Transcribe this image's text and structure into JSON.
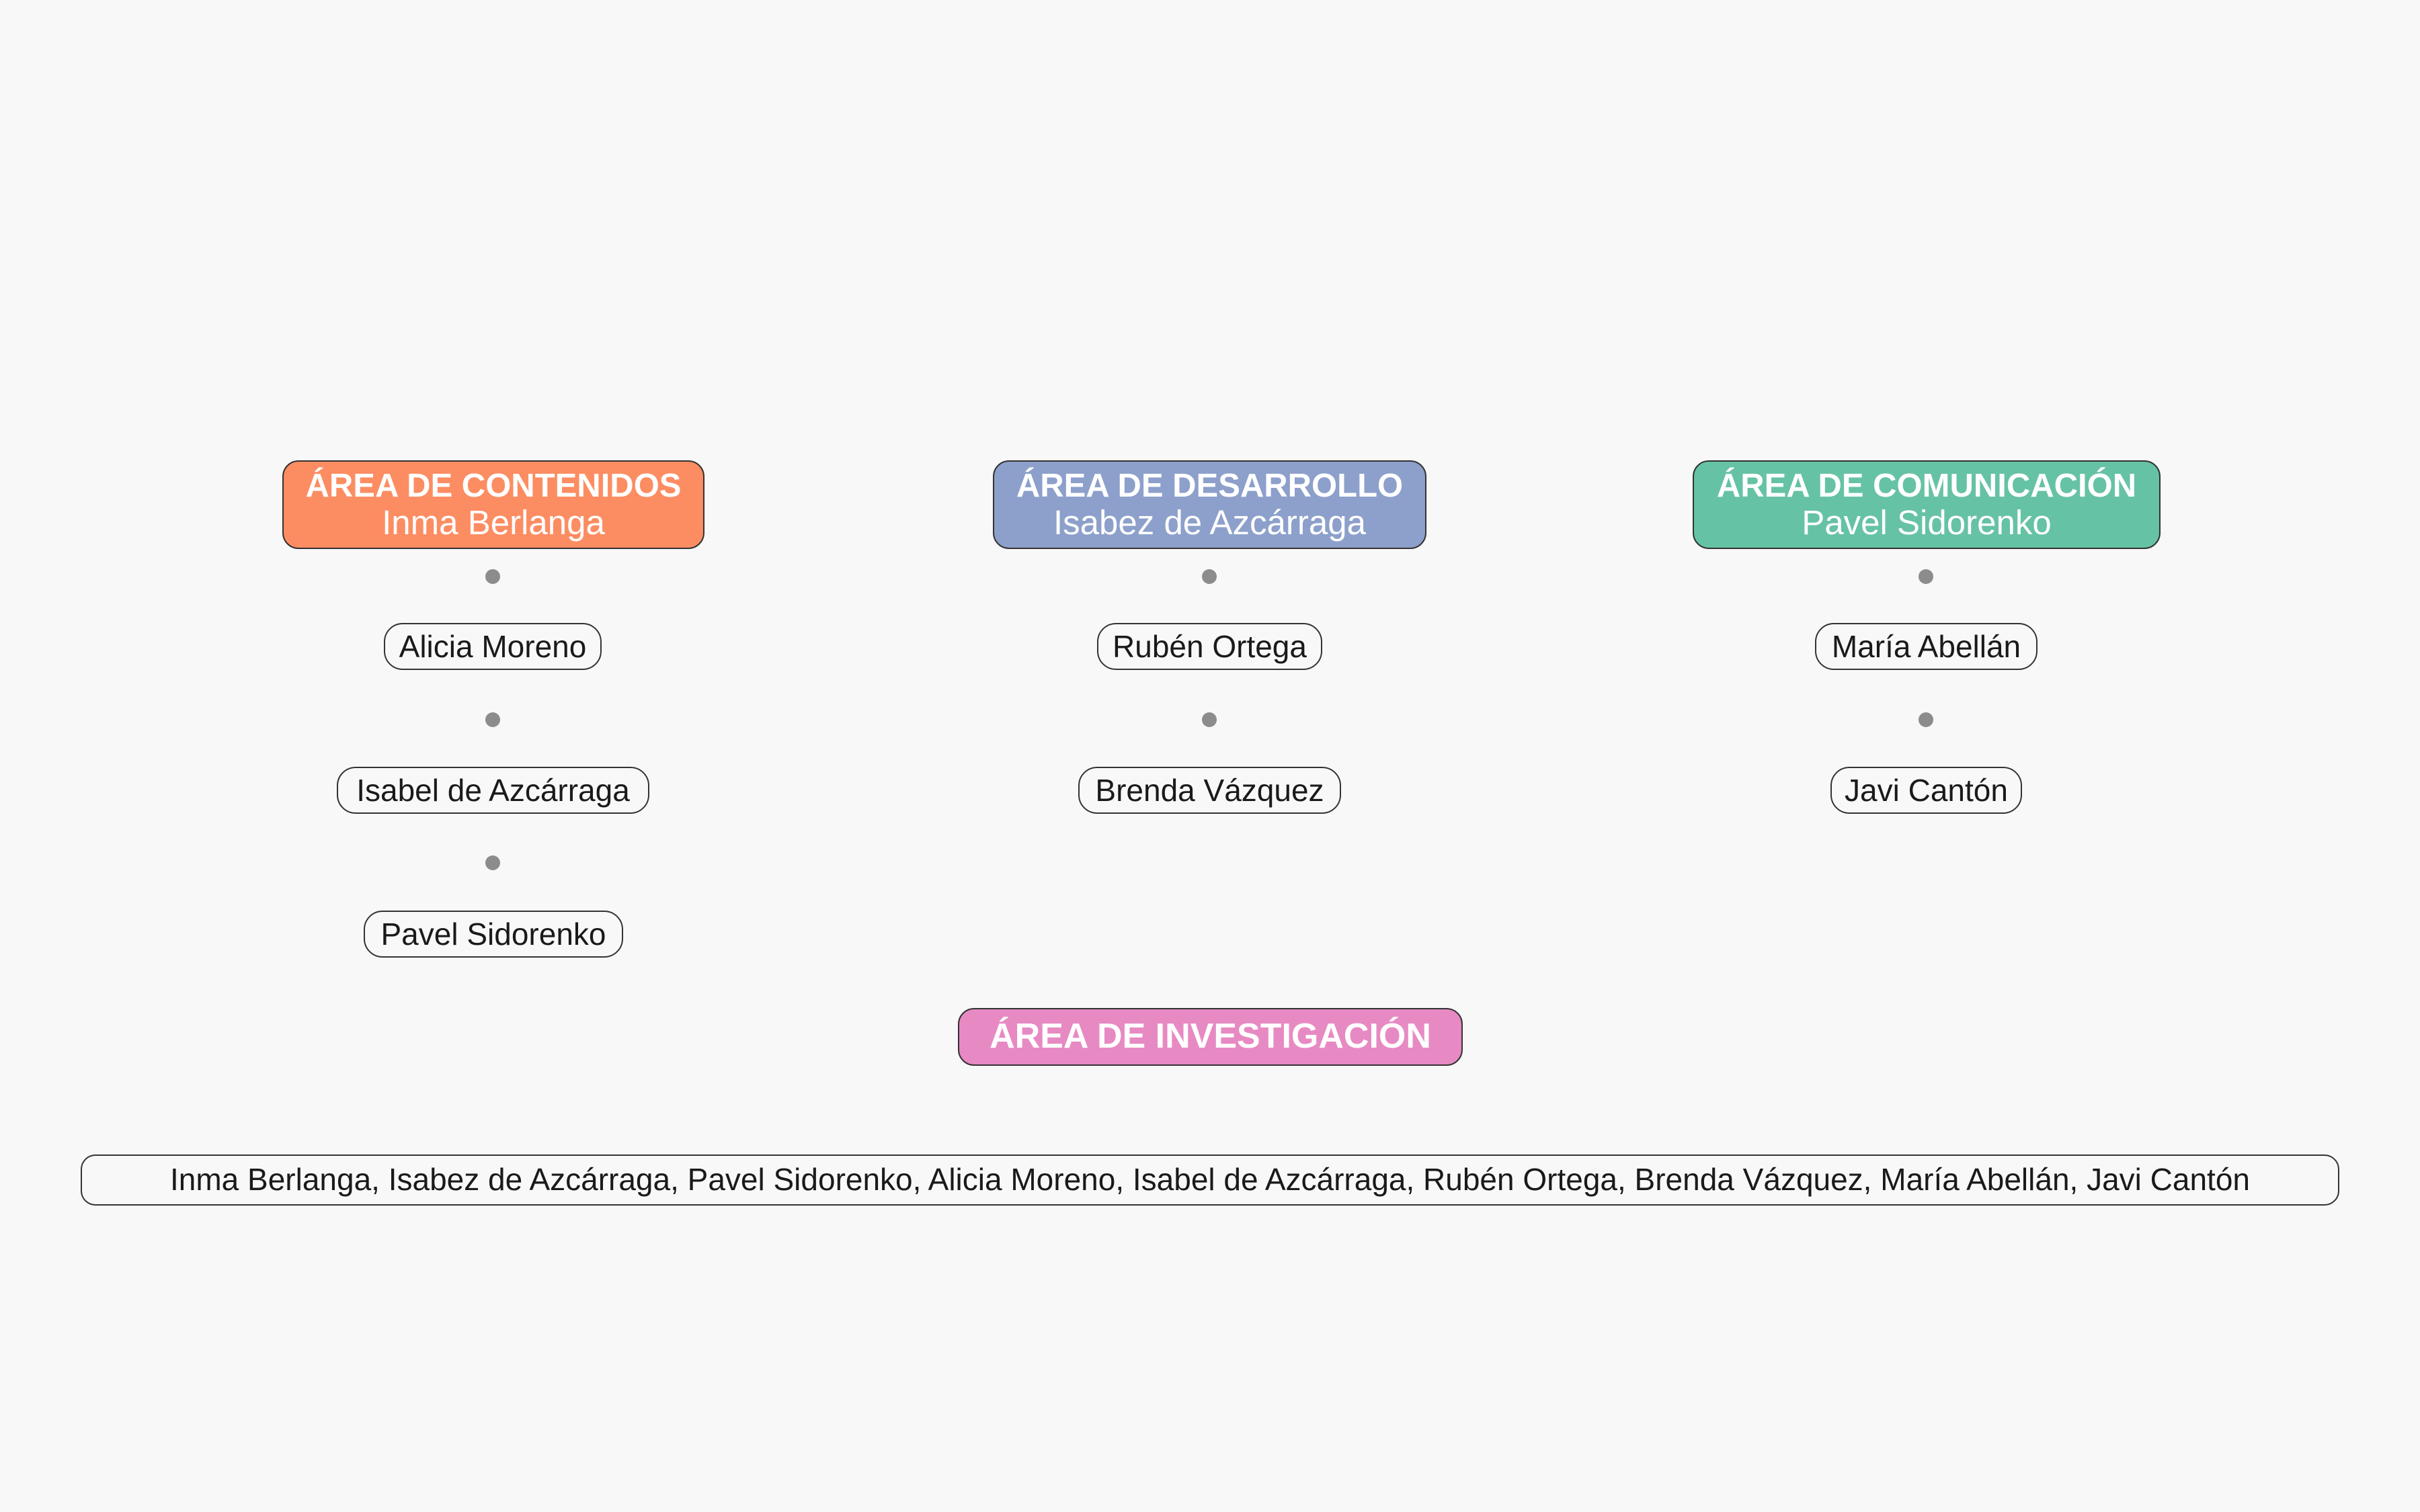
{
  "colors": {
    "contenidos": "#fc8d62",
    "desarrollo": "#8da0cb",
    "comunicacion": "#66c2a5",
    "investigacion": "#e78ac3",
    "connector_dot": "#8c8c8c",
    "border": "#333333",
    "background": "#f8f8f8"
  },
  "areas": [
    {
      "title": "ÁREA DE CONTENIDOS",
      "lead": "Inma Berlanga",
      "members": [
        "Alicia Moreno",
        "Isabel de Azcárraga",
        "Pavel Sidorenko"
      ]
    },
    {
      "title": "ÁREA DE DESARROLLO",
      "lead": "Isabez de Azcárraga",
      "members": [
        "Rubén Ortega",
        "Brenda Vázquez"
      ]
    },
    {
      "title": "ÁREA DE COMUNICACIÓN",
      "lead": "Pavel Sidorenko",
      "members": [
        "María Abellán",
        "Javi Cantón"
      ]
    }
  ],
  "investigacion": {
    "title": "ÁREA DE INVESTIGACIÓN",
    "members": "Inma Berlanga, Isabez de Azcárraga, Pavel Sidorenko, Alicia Moreno, Isabel de Azcárraga, Rubén Ortega, Brenda Vázquez, María Abellán, Javi Cantón"
  }
}
